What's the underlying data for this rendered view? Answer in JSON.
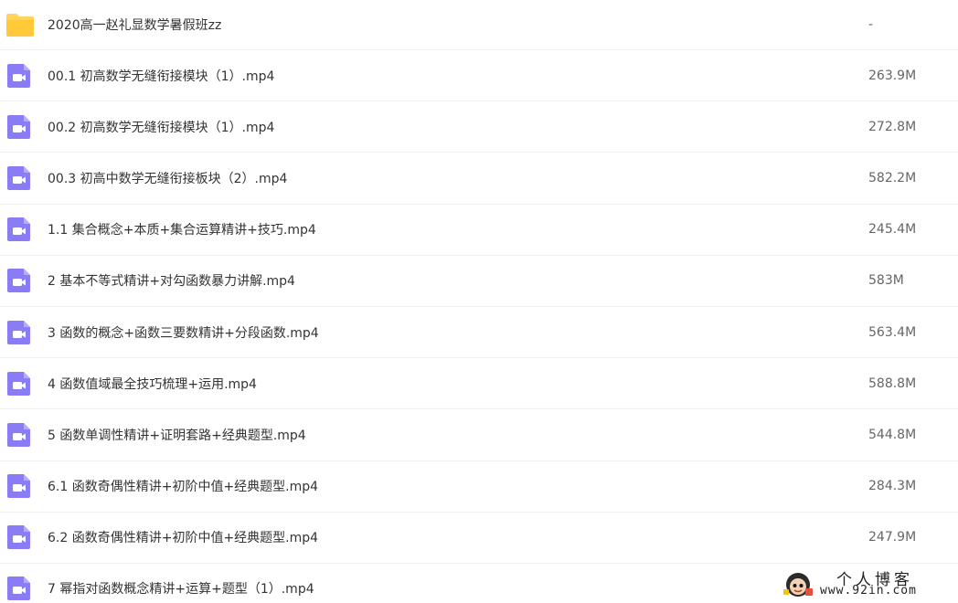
{
  "files": [
    {
      "type": "folder",
      "name": "2020高一赵礼显数学暑假班zz",
      "size": "-"
    },
    {
      "type": "video",
      "name": "00.1 初高数学无缝衔接模块（1）.mp4",
      "size": "263.9M"
    },
    {
      "type": "video",
      "name": "00.2 初高数学无缝衔接模块（1）.mp4",
      "size": "272.8M"
    },
    {
      "type": "video",
      "name": "00.3 初高中数学无缝衔接板块（2）.mp4",
      "size": "582.2M"
    },
    {
      "type": "video",
      "name": "1.1 集合概念+本质+集合运算精讲+技巧.mp4",
      "size": "245.4M"
    },
    {
      "type": "video",
      "name": "2 基本不等式精讲+对勾函数暴力讲解.mp4",
      "size": "583M"
    },
    {
      "type": "video",
      "name": "3 函数的概念+函数三要数精讲+分段函数.mp4",
      "size": "563.4M"
    },
    {
      "type": "video",
      "name": "4 函数值域最全技巧梳理+运用.mp4",
      "size": "588.8M"
    },
    {
      "type": "video",
      "name": "5 函数单调性精讲+证明套路+经典题型.mp4",
      "size": "544.8M"
    },
    {
      "type": "video",
      "name": "6.1 函数奇偶性精讲+初阶中值+经典题型.mp4",
      "size": "284.3M"
    },
    {
      "type": "video",
      "name": "6.2 函数奇偶性精讲+初阶中值+经典题型.mp4",
      "size": "247.9M"
    },
    {
      "type": "video",
      "name": "7 幂指对函数概念精讲+运算+题型（1）.mp4",
      "size": ""
    }
  ],
  "icons": {
    "folder": "folder-icon",
    "video": "video-file-icon"
  },
  "colors": {
    "folder": "#FFD35C",
    "video": "#8A7CF5",
    "text": "#333333",
    "size_text": "#666666"
  },
  "watermark": {
    "line1": "个人博客",
    "line2": "www.92in.com"
  }
}
